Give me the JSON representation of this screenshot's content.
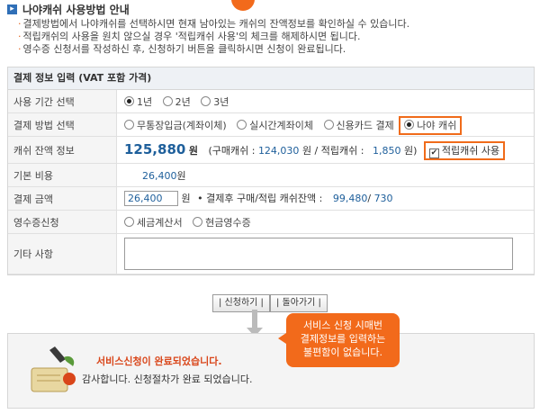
{
  "header": {
    "title": "나야캐쉬 사용방법 안내",
    "guide": [
      "결제방법에서 나야캐쉬를 선택하시면 현재 남아있는 캐쉬의 잔액정보를 확인하실 수 있습니다.",
      "적립캐쉬의 사용을 원치 않으실 경우 '적립캐쉬 사용'의 체크를 해제하시면 됩니다.",
      "영수증 신청서를 작성하신 후, 신청하기 버튼을 클릭하시면 신청이 완료됩니다."
    ]
  },
  "form": {
    "header": "결제 정보 입력 (VAT 포함 가격)",
    "period": {
      "label": "사용 기간 선택",
      "options": [
        "1년",
        "2년",
        "3년"
      ],
      "selected": 0
    },
    "method": {
      "label": "결제 방법 선택",
      "options": [
        "무통장입금(계좌이체)",
        "실시간계좌이체",
        "신용카드 결제",
        "나야 캐쉬"
      ],
      "selected": 3
    },
    "cash": {
      "label": "캐쉬 잔액 정보",
      "amount": "125,880",
      "unit": "원",
      "detail_prefix": "(구매캐쉬 :",
      "purchase": "124,030",
      "detail_mid": "원 / 적립캐쉬 :",
      "reserve": "1,850",
      "detail_suffix": "원)",
      "use_reserve_label": "적립캐쉬 사용",
      "use_reserve_checked": true
    },
    "base_cost": {
      "label": "기본 비용",
      "value": "26,400",
      "unit": "원"
    },
    "payment": {
      "label": "결제 금액",
      "input_value": "26,400",
      "unit": "원",
      "note": "• 결제후 구매/적립 캐쉬잔액 :",
      "after_purchase": "99,480",
      "sep": "/",
      "after_reserve": "730"
    },
    "receipt": {
      "label": "영수증신청",
      "options": [
        "세금계산서",
        "현금영수증"
      ]
    },
    "memo": {
      "label": "기타 사항"
    }
  },
  "buttons": {
    "apply": "| 신청하기 |",
    "back": "| 돌아가기 |"
  },
  "tooltip": [
    "서비스 신청 시매번",
    "결제정보를 입력하는",
    "불편함이 없습니다."
  ],
  "complete": {
    "title": "서비스신청이 완료되었습니다.",
    "sub": "감사합니다. 신청절차가 완료 되었습니다."
  },
  "colors": {
    "accent": "#f26a1b",
    "blue": "#1e5f9b",
    "alert": "#d9461a"
  }
}
